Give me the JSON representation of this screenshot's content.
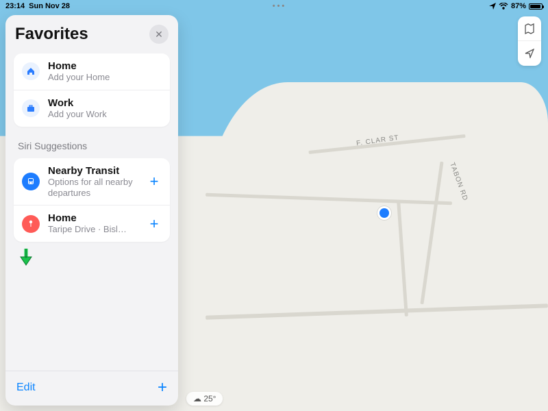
{
  "status_bar": {
    "time": "23:14",
    "date": "Sun Nov 28",
    "battery_percent": "87%"
  },
  "panel": {
    "title": "Favorites",
    "favorites": [
      {
        "title": "Home",
        "subtitle": "Add your Home"
      },
      {
        "title": "Work",
        "subtitle": "Add your Work"
      }
    ],
    "siri_section_label": "Siri Suggestions",
    "siri_suggestions": [
      {
        "title": "Nearby Transit",
        "subtitle": "Options for all nearby departures"
      },
      {
        "title": "Home",
        "subtitle": "Taripe Drive · Bisl…"
      }
    ],
    "footer": {
      "edit": "Edit",
      "add_glyph": "+"
    }
  },
  "map": {
    "road_labels": {
      "clar": "F. CLAR ST",
      "tabon": "TABON RD"
    },
    "weather": "☁ 25°",
    "controls": {
      "mode_icon": "map-mode-icon",
      "locate_icon": "locate-icon"
    }
  },
  "icons": {
    "close": "✕",
    "plus": "+",
    "home": "⌂",
    "work": "⎆",
    "transit": "⊜",
    "pin": "📍",
    "arrow": "➤",
    "map_mode": "𝌆"
  }
}
